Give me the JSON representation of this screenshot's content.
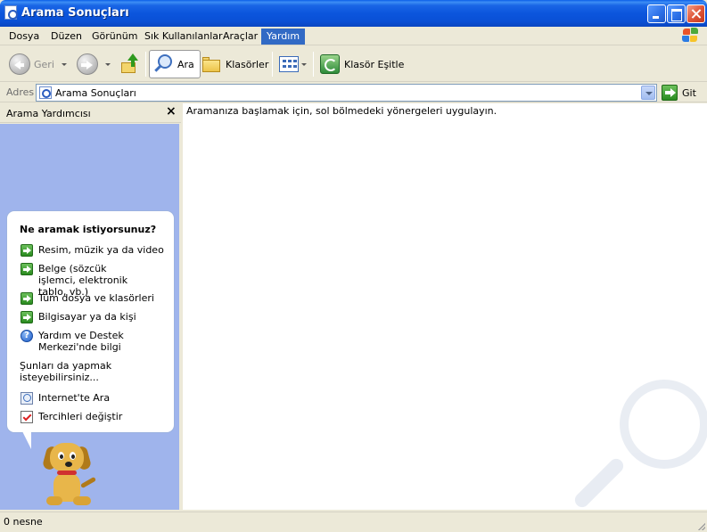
{
  "window": {
    "title": "Arama Sonuçları"
  },
  "menu": [
    {
      "label": "Dosya",
      "active": false
    },
    {
      "label": "Düzen",
      "active": false
    },
    {
      "label": "Görünüm",
      "active": false
    },
    {
      "label": "Sık Kullanılanlar",
      "active": false
    },
    {
      "label": "Araçlar",
      "active": false
    },
    {
      "label": "Yardım",
      "active": true
    }
  ],
  "toolbar": {
    "back_label": "Geri",
    "search_label": "Ara",
    "folders_label": "Klasörler",
    "sync_label": "Klasör Eşitle",
    "back_enabled": false,
    "forward_enabled": false
  },
  "address": {
    "label": "Adres",
    "value": "Arama Sonuçları",
    "go_label": "Git"
  },
  "sidepanel": {
    "title": "Arama Yardımcısı",
    "close_glyph": "×",
    "heading": "Ne aramak istiyorsunuz?",
    "options": [
      {
        "label": "Resim, müzik ya da video",
        "icon": "green-arrow-icon"
      },
      {
        "label": "Belge (sözcük işlemci, elektronik tablo, vb.)",
        "icon": "green-arrow-icon"
      },
      {
        "label": "Tüm dosya ve klasörleri",
        "icon": "green-arrow-icon"
      },
      {
        "label": "Bilgisayar ya da kişi",
        "icon": "green-arrow-icon"
      },
      {
        "label": "Yardım ve Destek Merkezi'nde bilgi",
        "icon": "help-icon"
      }
    ],
    "also_text": "Şunları da yapmak isteyebilirsiniz...",
    "actions": [
      {
        "label": "Internet'te Ara",
        "icon": "internet-search-icon"
      },
      {
        "label": "Tercihleri değiştir",
        "icon": "preferences-icon"
      }
    ]
  },
  "main": {
    "hint": "Aramanıza başlamak için, sol bölmedeki yönergeleri uygulayın."
  },
  "status": {
    "text": "0 nesne"
  },
  "colors": {
    "titlebar": "#0a55dd",
    "menu_active": "#316ac5",
    "sidepanel_bg": "#9fb4ec",
    "chrome": "#ece9d8"
  }
}
